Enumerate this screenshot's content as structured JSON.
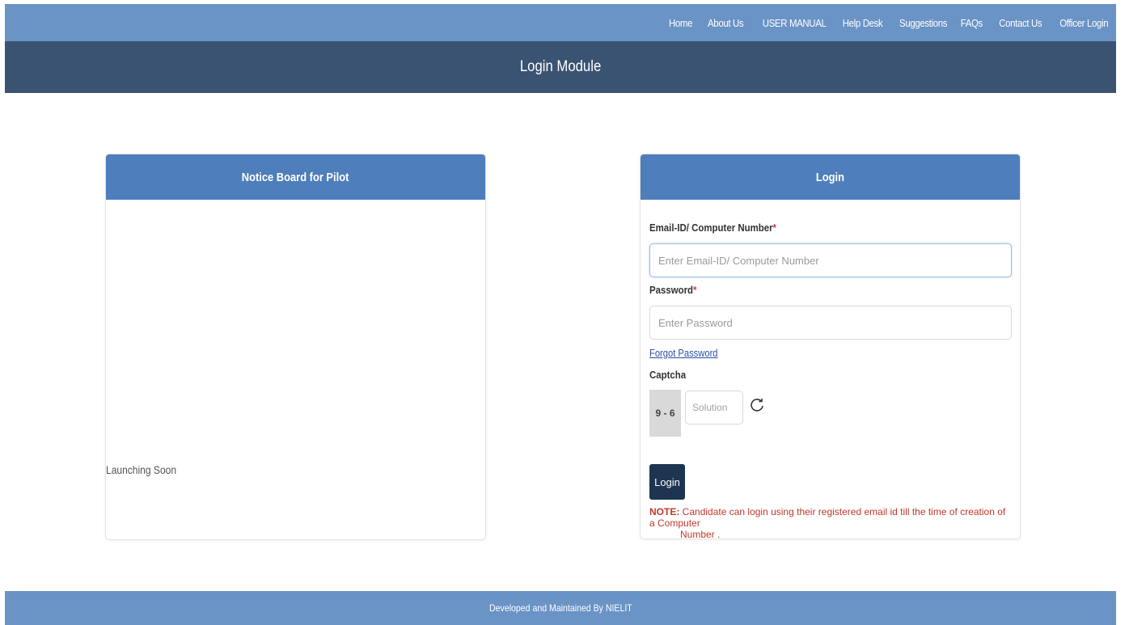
{
  "nav": {
    "items": [
      "Home",
      "About Us",
      "USER MANUAL",
      "Help Desk",
      "Suggestions",
      "FAQs",
      "Contact Us",
      "Officer Login"
    ]
  },
  "header": {
    "title": "Login Module"
  },
  "notice": {
    "title": "Notice Board for Pilot",
    "text": "Launching Soon"
  },
  "login": {
    "title": "Login",
    "email_label": "Email-ID/ Computer Number",
    "email_placeholder": "Enter Email-ID/ Computer Number",
    "password_label": "Password",
    "password_placeholder": "Enter Password",
    "required_mark": "*",
    "forgot_label": "Forgot Password",
    "captcha_label": "Captcha",
    "captcha_value": "9 - 6",
    "solution_placeholder": "Solution",
    "button_label": "Login",
    "note_prefix": "NOTE:",
    "note_text": " Candidate can login using their registered email id till the time of creation of a Computer",
    "note_text2": "Number ."
  },
  "footer": {
    "text": "Developed and Maintained By NIELIT"
  },
  "colors": {
    "nav_bg": "#6a93c6",
    "title_bg": "#3b5372",
    "card_header_bg": "#4e7ebb",
    "button_bg": "#1d3550",
    "note_color": "#c0392b"
  },
  "icons": {
    "refresh": "refresh-icon"
  }
}
